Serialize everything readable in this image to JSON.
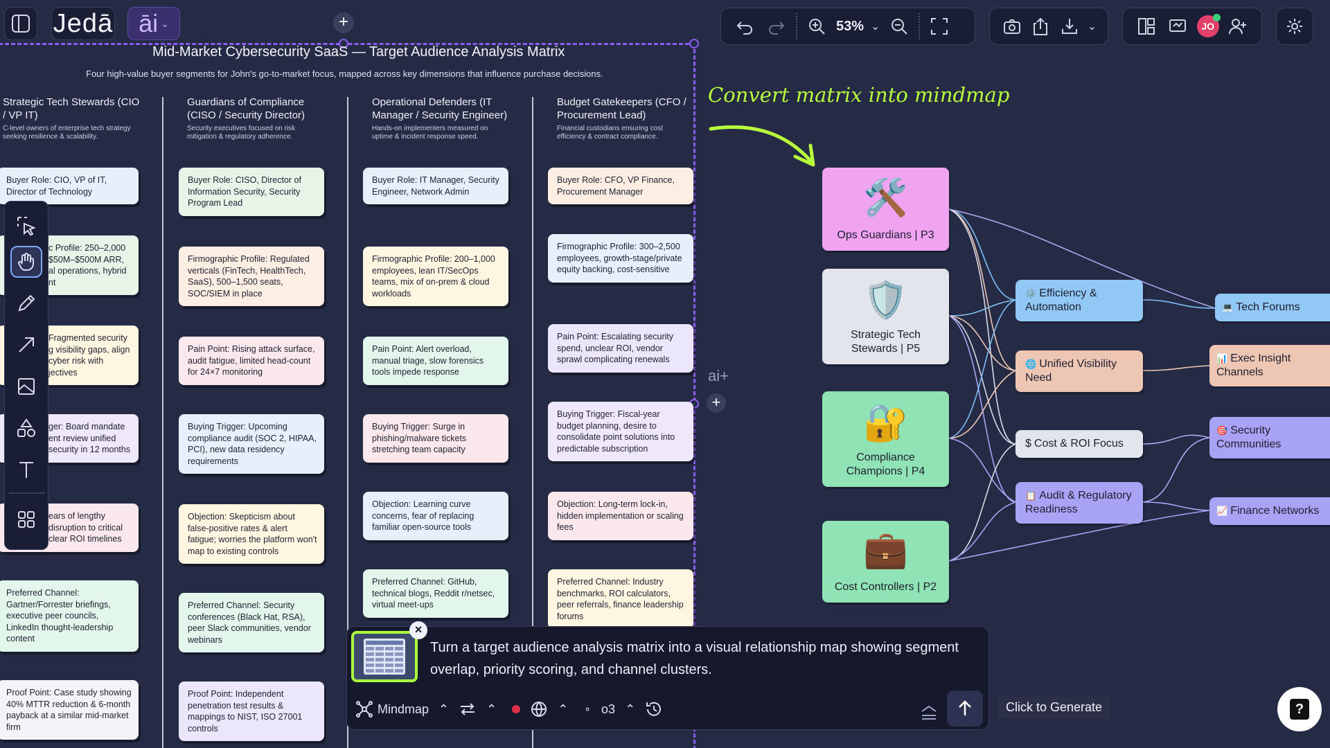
{
  "brand": {
    "name": "Jedā",
    "ai_logo": "āi"
  },
  "toolbar": {
    "zoom": "53%"
  },
  "avatar": {
    "initials": "JO"
  },
  "matrix": {
    "title": "Mid-Market Cybersecurity SaaS — Target Audience Analysis Matrix",
    "subtitle": "Four high-value buyer segments for John's go-to-market focus, mapped across key dimensions that influence purchase decisions.",
    "columns": [
      {
        "title": "Strategic Tech Stewards (CIO / VP IT)",
        "desc": "C-level owners of enterprise tech strategy seeking resilience & scalability.",
        "cards": [
          "Buyer Role: CIO, VP of IT, Director of Technology",
          "c Profile: 250–2,000 $50M–$500M ARR, al operations, hybrid nt",
          "Fragmented security g visibility gaps, align cyber risk with jectives",
          "ger: Board mandate ent review unified security in 12 months",
          "ears of lengthy disruption to critical clear ROI timelines",
          "Preferred Channel: Gartner/Forrester briefings, executive peer councils, LinkedIn thought-leadership content",
          "Proof Point: Case study showing 40% MTTR reduction & 6-month payback at a similar mid-market firm"
        ]
      },
      {
        "title": "Guardians of Compliance (CISO / Security Director)",
        "desc": "Security executives focused on risk mitigation & regulatory adherence.",
        "cards": [
          "Buyer Role: CISO, Director of Information Security, Security Program Lead",
          "Firmographic Profile: Regulated verticals (FinTech, HealthTech, SaaS), 500–1,500 seats, SOC/SIEM in place",
          "Pain Point: Rising attack surface, audit fatigue, limited head-count for 24×7 monitoring",
          "Buying Trigger: Upcoming compliance audit (SOC 2, HIPAA, PCI), new data residency requirements",
          "Objection: Skepticism about false-positive rates & alert fatigue; worries the platform won't map to existing controls",
          "Preferred Channel: Security conferences (Black Hat, RSA), peer Slack communities, vendor webinars",
          "Proof Point: Independent penetration test results & mappings to NIST, ISO 27001 controls"
        ]
      },
      {
        "title": "Operational Defenders (IT Manager / Security Engineer)",
        "desc": "Hands-on implementers measured on uptime & incident response speed.",
        "cards": [
          "Buyer Role: IT Manager, Security Engineer, Network Admin",
          "Firmographic Profile: 200–1,000 employees, lean IT/SecOps teams, mix of on-prem & cloud workloads",
          "Pain Point: Alert overload, manual triage, slow forensics tools impede response",
          "Buying Trigger: Surge in phishing/malware tickets stretching team capacity",
          "Objection: Learning curve concerns, fear of replacing familiar open-source tools",
          "Preferred Channel: GitHub, technical blogs, Reddit r/netsec, virtual meet-ups"
        ]
      },
      {
        "title": "Budget Gatekeepers (CFO / Procurement Lead)",
        "desc": "Financial custodians ensuring cost efficiency & contract compliance.",
        "cards": [
          "Buyer Role: CFO, VP Finance, Procurement Manager",
          "Firmographic Profile: 300–2,500 employees, growth-stage/private equity backing, cost-sensitive",
          "Pain Point: Escalating security spend, unclear ROI, vendor sprawl complicating renewals",
          "Buying Trigger: Fiscal-year budget planning, desire to consolidate point solutions into predictable subscription",
          "Objection: Long-term lock-in, hidden implementation or scaling fees",
          "Preferred Channel: Industry benchmarks, ROI calculators, peer referrals, finance leadership forums"
        ]
      }
    ]
  },
  "annotation": "Convert matrix into mindmap",
  "ai_plus": "ai+",
  "mindmap": {
    "personas": [
      {
        "icon": "🛠️",
        "label": "Ops Guardians | P3",
        "color": "#f0a3f0"
      },
      {
        "icon": "🛡️",
        "label": "Strategic Tech Stewards | P5",
        "color": "#e3e5ec"
      },
      {
        "icon": "🔐",
        "label": "Compliance Champions | P4",
        "color": "#8fe3b4"
      },
      {
        "icon": "💼",
        "label": "Cost Controllers | P2",
        "color": "#8fe3b4"
      }
    ],
    "needs": [
      {
        "icon": "⚙️",
        "label": "Efficiency & Automation",
        "color": "#92c8f5"
      },
      {
        "icon": "🌐",
        "label": "Unified Visibility Need",
        "color": "#eec7b4"
      },
      {
        "icon": "$",
        "label": "Cost & ROI Focus",
        "color": "#e3e5ec"
      },
      {
        "icon": "📋",
        "label": "Audit & Regulatory Readiness",
        "color": "#a9a3f5"
      }
    ],
    "channels": [
      {
        "icon": "💻",
        "label": "Tech Forums",
        "color": "#92c8f5"
      },
      {
        "icon": "📊",
        "label": "Exec Insight Channels",
        "color": "#eec7b4"
      },
      {
        "icon": "🎯",
        "label": "Security Communities",
        "color": "#a9a3f5"
      },
      {
        "icon": "📈",
        "label": "Finance Networks",
        "color": "#a9a3f5"
      }
    ]
  },
  "prompt": {
    "text": "Turn a target audience analysis matrix into a visual relationship map showing segment overlap, priority scoring, and channel clusters.",
    "mode": "Mindmap",
    "model": "o3",
    "generate_label": "Click to Generate",
    "help": "?"
  }
}
